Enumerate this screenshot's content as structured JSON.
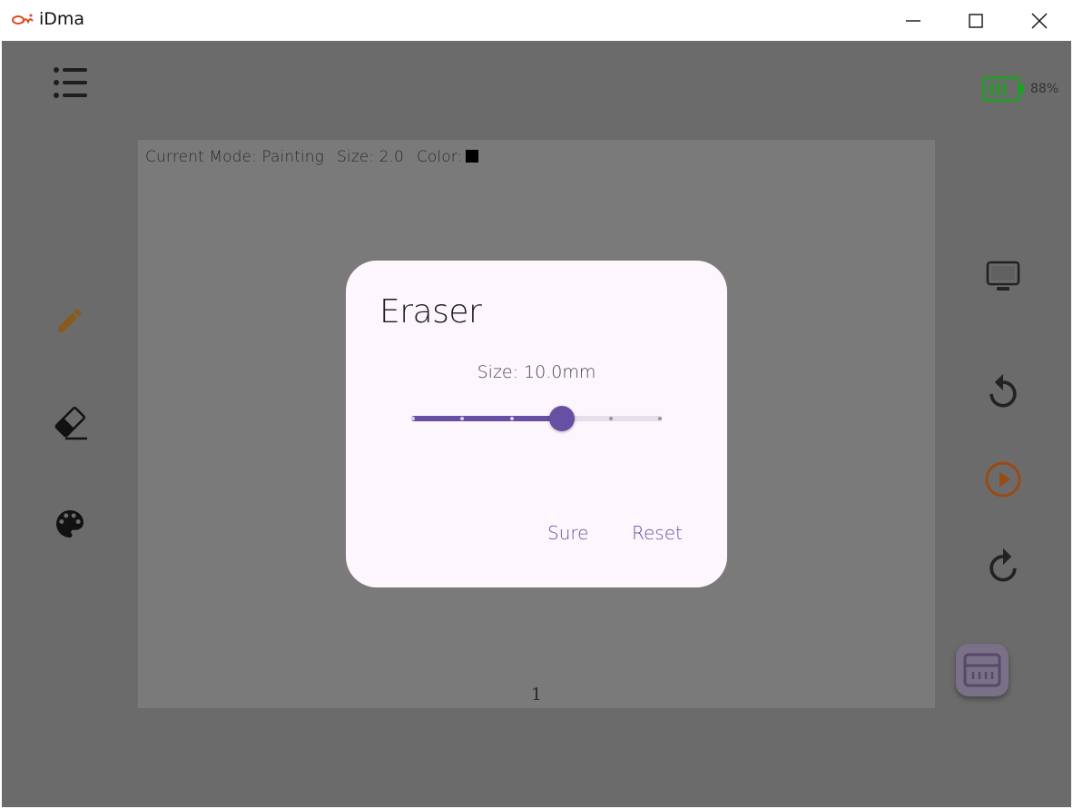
{
  "window": {
    "title": "iDma",
    "minimize_icon": "minimize-icon",
    "maximize_icon": "maximize-icon",
    "close_icon": "close-icon"
  },
  "toolbar_left": {
    "menu_icon": "menu-list-icon",
    "pencil_icon": "pencil-icon",
    "eraser_icon": "eraser-icon",
    "palette_icon": "palette-icon"
  },
  "status": {
    "mode": "Current Mode: Painting",
    "size": "Size: 2.0",
    "color_label": "Color:",
    "color_value": "#000000"
  },
  "battery": {
    "percent_label": "88%",
    "level": 0.88,
    "color": "#1aa321"
  },
  "toolbar_right": {
    "screen_icon": "monitor-icon",
    "undo_icon": "rotate-ccw-icon",
    "play_icon": "play-circle-icon",
    "redo_icon": "rotate-cw-icon",
    "fab_icon": "keyboard-panel-icon"
  },
  "canvas": {
    "page_number": "1"
  },
  "dialog": {
    "title": "Eraser",
    "size_label": "Size: 10.0mm",
    "slider": {
      "value_fraction": 0.6,
      "ticks": 6
    },
    "sure_label": "Sure",
    "reset_label": "Reset"
  },
  "colors": {
    "accent": "#6750a4",
    "pencil": "#8a5a1c",
    "play": "#9a4a12",
    "overlay": "#6b6b6b"
  }
}
